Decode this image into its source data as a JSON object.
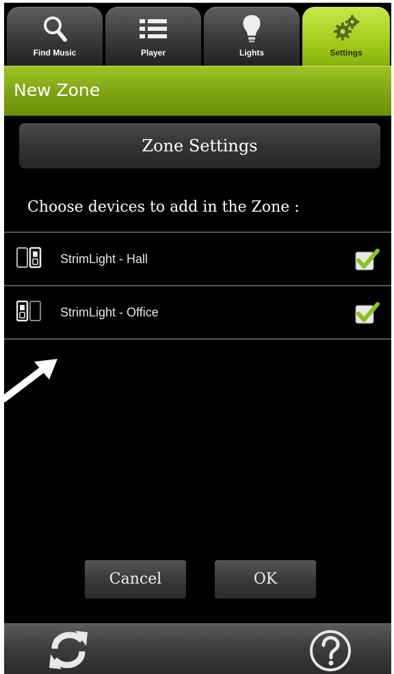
{
  "tabs": [
    {
      "label": "Find Music",
      "icon": "search-icon"
    },
    {
      "label": "Player",
      "icon": "list-icon"
    },
    {
      "label": "Lights",
      "icon": "bulb-icon"
    },
    {
      "label": "Settings",
      "icon": "gears-icon",
      "active": true
    }
  ],
  "header": {
    "title": "New Zone"
  },
  "zone_settings_label": "Zone Settings",
  "prompt": "Choose devices to add in the Zone :",
  "devices": [
    {
      "name": "StrimLight - Hall",
      "checked": true
    },
    {
      "name": "StrimLight - Office",
      "checked": true
    }
  ],
  "actions": {
    "cancel": "Cancel",
    "ok": "OK"
  },
  "colors": {
    "accent": "#8ab41a",
    "background": "#000000"
  }
}
